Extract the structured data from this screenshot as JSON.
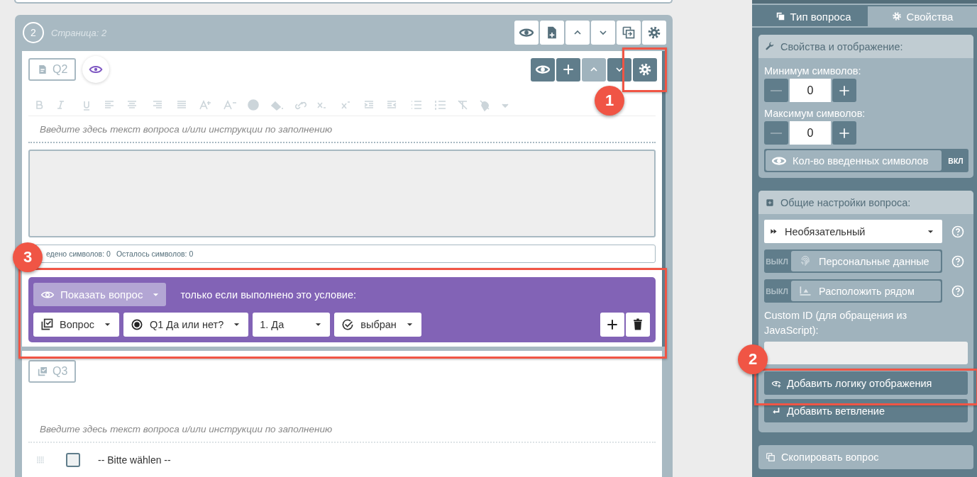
{
  "page": {
    "number": "2",
    "title": "Страница: 2"
  },
  "question2": {
    "label": "Q2",
    "toolbar": [
      {
        "kind": "eye",
        "disabled": false
      },
      {
        "kind": "plus",
        "disabled": false
      },
      {
        "kind": "up",
        "disabled": true
      },
      {
        "kind": "down",
        "disabled": false
      },
      {
        "kind": "settings",
        "disabled": false
      }
    ],
    "placeholder": "Введите здесь текст вопроса и/или инструкции по заполнению",
    "counter": "едено символов: 0",
    "remaining": "Осталось символов: 0",
    "logic": {
      "action": "Показать вопрос",
      "condition": "только если выполнено это условие:",
      "selects": [
        {
          "kind": "question",
          "value": "Вопрос"
        },
        {
          "kind": "radio",
          "value": "Q1 Да или нет?"
        },
        {
          "kind": "plain",
          "value": "1. Да"
        },
        {
          "kind": "check",
          "value": "выбран"
        }
      ]
    }
  },
  "question3": {
    "label": "Q3",
    "placeholder": "Введите здесь текст вопроса и/или инструкции по заполнению",
    "options": [
      {
        "label": "-- Bitte wählen --",
        "checked": false
      }
    ]
  },
  "sidebar": {
    "tabs": [
      {
        "label": "Тип вопроса",
        "selected": false
      },
      {
        "label": "Свойства",
        "selected": true
      }
    ],
    "properties": {
      "title": "Свойства и отображение:",
      "min_label": "Минимум символов:",
      "min_value": "0",
      "max_label": "Максимум символов:",
      "max_value": "0",
      "toggle": {
        "label": "Кол-во введенных символов",
        "state": "ВКЛ",
        "on": true
      }
    },
    "general": {
      "title": "Общие настройки вопроса:",
      "required": "Необязательный",
      "toggles": [
        {
          "label": "Персональные данные",
          "state": "ВЫКЛ",
          "on": false,
          "kind": "fingerprint"
        },
        {
          "label": "Расположить рядом",
          "state": "ВЫКЛ",
          "on": false,
          "kind": "align"
        }
      ],
      "custom_id_label": "Custom ID (для обращения из JavaScript):",
      "buttons": [
        {
          "kind": "logic",
          "label": "Добавить логику отображения"
        },
        {
          "kind": "branch",
          "label": "Добавить ветвление"
        }
      ]
    },
    "copy": "Скопировать вопрос"
  },
  "callouts": [
    {
      "number": "1"
    },
    {
      "number": "2"
    },
    {
      "number": "3"
    }
  ]
}
